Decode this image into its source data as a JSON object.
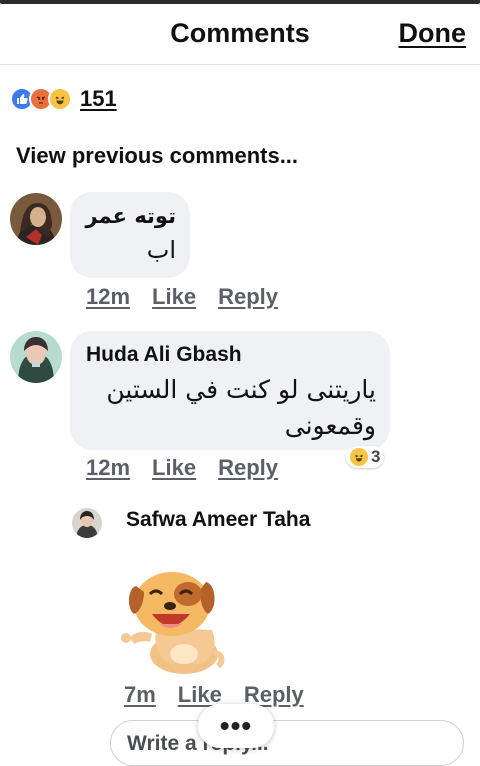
{
  "header": {
    "title": "Comments",
    "done_label": "Done"
  },
  "reactions": {
    "icons": [
      "like-icon",
      "angry-icon",
      "haha-icon"
    ],
    "count": "151"
  },
  "view_previous": "View previous comments...",
  "comments": [
    {
      "author": "توته عمر",
      "text_line": "اب",
      "time": "12m",
      "like_label": "Like",
      "reply_label": "Reply"
    },
    {
      "author": "Huda Ali Gbash",
      "text_line1": "ياريتنى لو كنت في الستين",
      "text_line2": "وقمعونى",
      "time": "12m",
      "like_label": "Like",
      "reply_label": "Reply",
      "reaction": {
        "icon": "haha-icon",
        "count": "3"
      }
    }
  ],
  "reply": {
    "author": "Safwa Ameer Taha",
    "sticker": "laughing-puppy-sticker",
    "time": "7m",
    "like_label": "Like",
    "reply_label": "Reply"
  },
  "composer": {
    "placeholder": "Write a reply..."
  },
  "more_button": {
    "label": "•••"
  },
  "colors": {
    "bubble": "#f0f1f4",
    "like_blue": "#3b7bf2",
    "meta_gray": "#5c6066"
  }
}
